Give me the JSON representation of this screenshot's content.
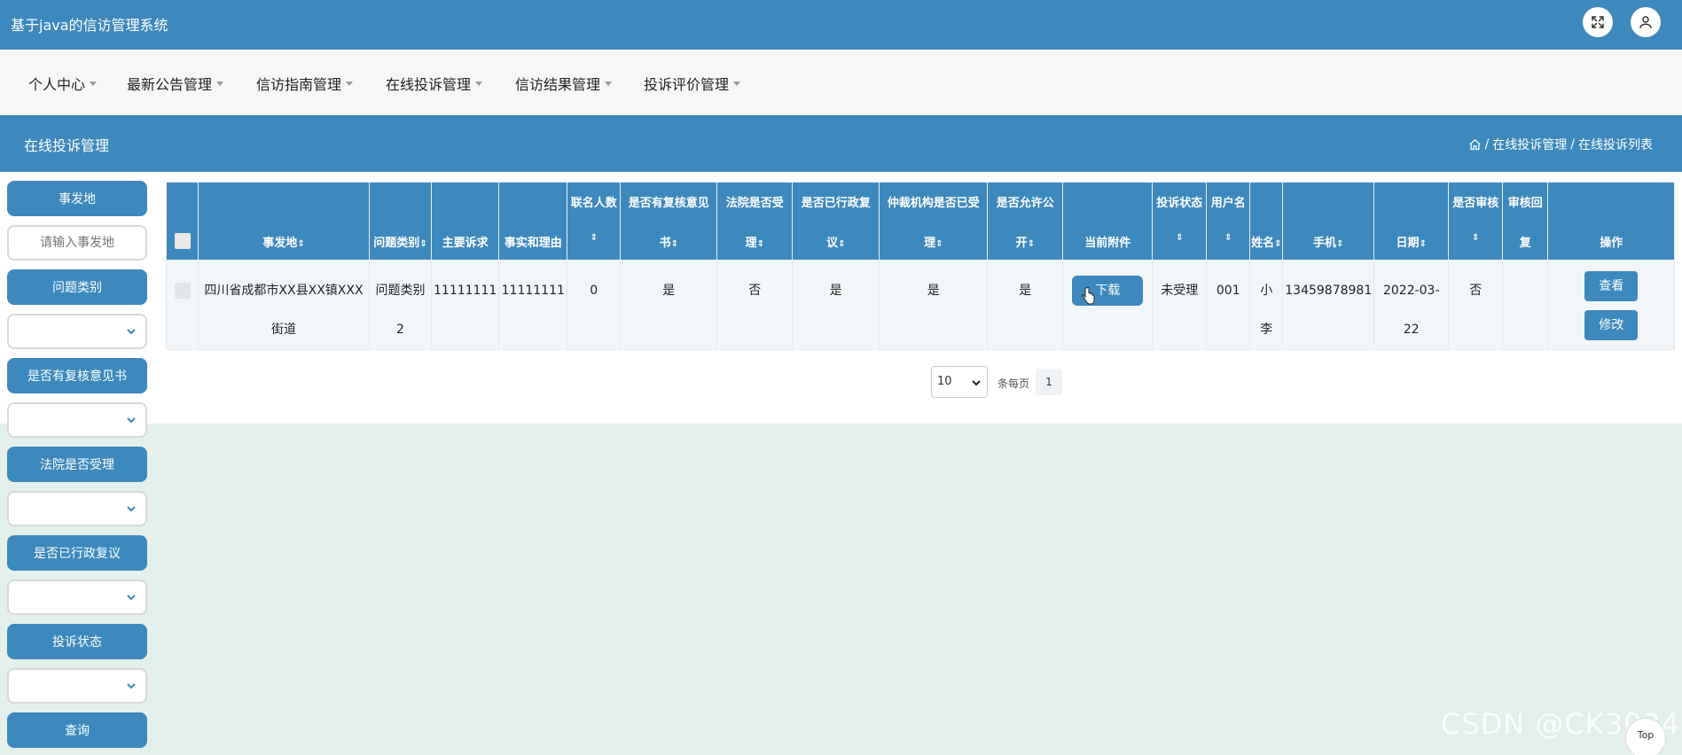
{
  "app": {
    "title": "基于java的信访管理系统"
  },
  "nav": {
    "items": [
      {
        "label": "个人中心"
      },
      {
        "label": "最新公告管理"
      },
      {
        "label": "信访指南管理"
      },
      {
        "label": "在线投诉管理"
      },
      {
        "label": "信访结果管理"
      },
      {
        "label": "投诉评价管理"
      }
    ]
  },
  "page": {
    "title": "在线投诉管理",
    "breadcrumb": {
      "sep": "/",
      "item1": "在线投诉管理",
      "item2": "在线投诉列表"
    }
  },
  "filters": {
    "location_label": "事发地",
    "location_placeholder": "请输入事发地",
    "category_label": "问题类别",
    "review_label": "是否有复核意见书",
    "court_label": "法院是否受理",
    "admin_label": "是否已行政复议",
    "status_label": "投诉状态",
    "query_button": "查询"
  },
  "table": {
    "sort_glyph": "⇕",
    "headers": {
      "location": "事发地",
      "category": "问题类别",
      "main_claim": "主要诉求",
      "facts": "事实和理由",
      "joint_count": "联名人数",
      "review_line1": "是否有复核意见",
      "review_line2": "书",
      "court_line1": "法院是否受",
      "court_line2": "理",
      "admin_line1": "是否已行政复",
      "admin_line2": "议",
      "arbitration_line1": "仲裁机构是否已受",
      "arbitration_line2": "理",
      "public_line1": "是否允许公",
      "public_line2": "开",
      "attachment": "当前附件",
      "status": "投诉状态",
      "username": "用户名",
      "name": "姓名",
      "phone": "手机",
      "date": "日期",
      "audited": "是否审核",
      "audit_reply_line1": "审核回",
      "audit_reply_line2": "复",
      "actions": "操作"
    },
    "row": {
      "location_line1": "四川省成都市XX县XX镇XXX",
      "location_line2": "街道",
      "category_line1": "问题类别",
      "category_line2": "2",
      "main_claim": "11111111",
      "facts": "11111111",
      "joint_count": "0",
      "review": "是",
      "court": "否",
      "admin": "是",
      "arbitration": "是",
      "public": "是",
      "download_button": "下载",
      "status": "未受理",
      "username": "001",
      "name_line1": "小",
      "name_line2": "李",
      "phone": "13459878981",
      "date_line1": "2022-03-",
      "date_line2": "22",
      "audited": "否",
      "audit_reply": "",
      "view_button": "查看",
      "edit_button": "修改"
    }
  },
  "pagination": {
    "page_size": "10",
    "per_page_label": "条每页",
    "current_page": "1"
  },
  "watermark": "CSDN @CK3034",
  "back_to_top": "Top",
  "colors": {
    "primary": "#3d89bd",
    "background": "#e3f0ec",
    "nav_bg": "#f7f7f7"
  }
}
